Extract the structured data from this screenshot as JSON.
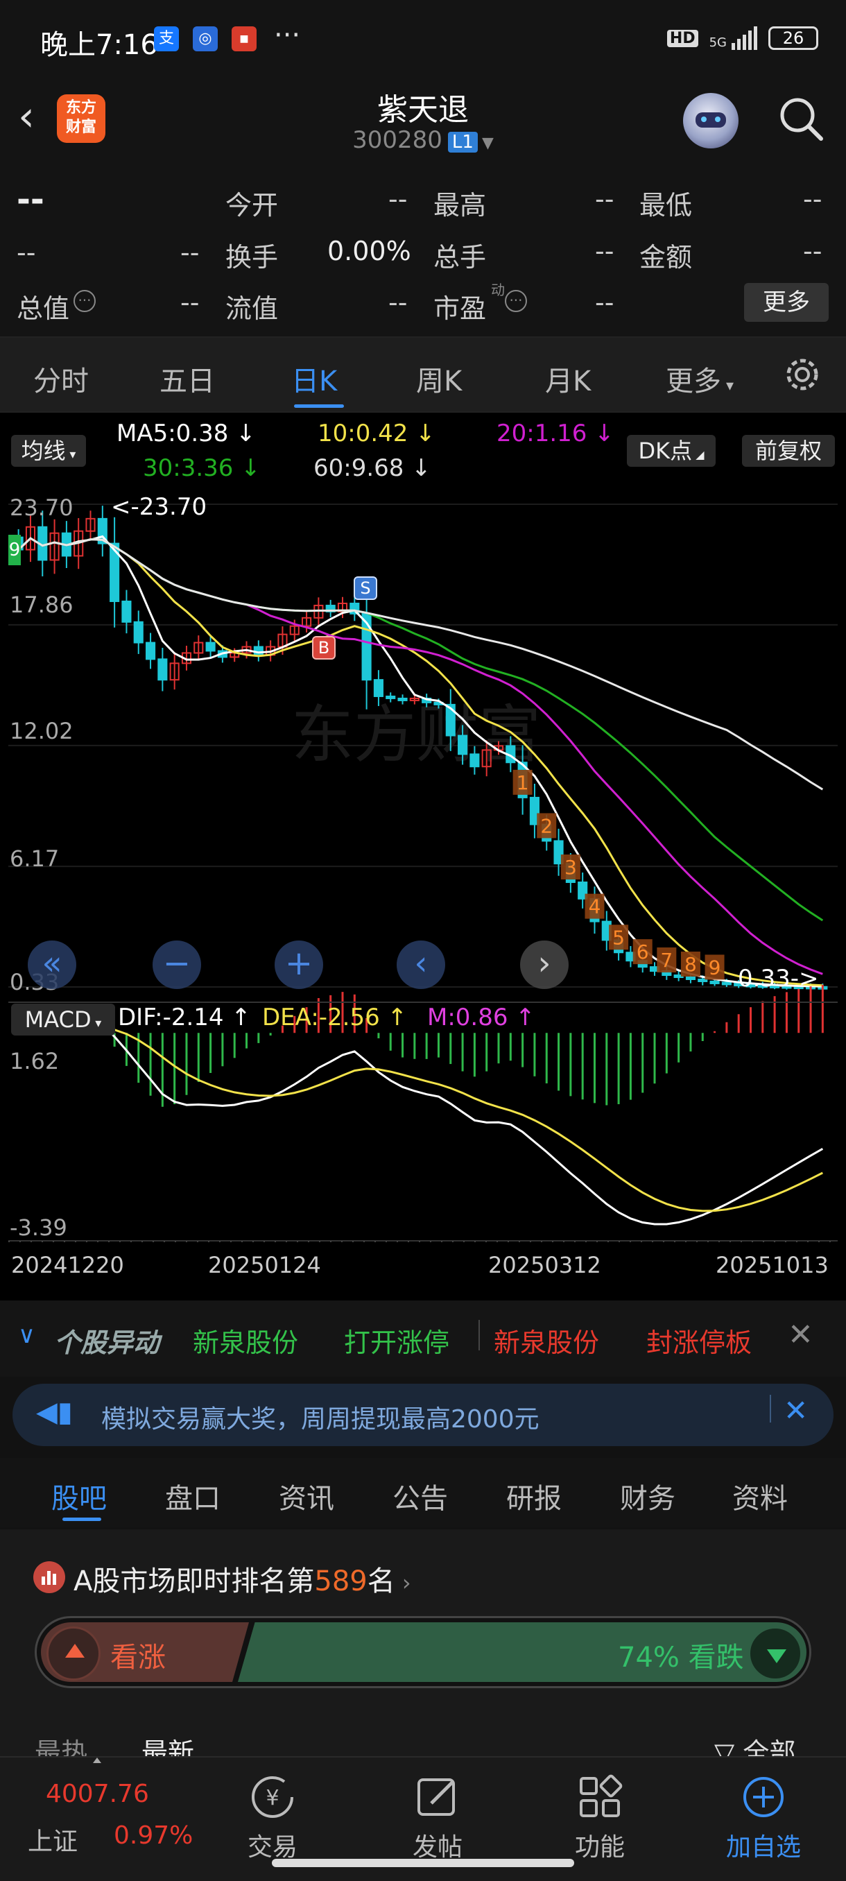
{
  "status_bar": {
    "time": "晚上7:16",
    "dots": "···",
    "hd": "HD",
    "signal": "5G",
    "battery": "26"
  },
  "header": {
    "logo": "东方\n财富",
    "title": "紫天退",
    "code": "300280",
    "level": "L1"
  },
  "quote": {
    "price": "--",
    "change": "--",
    "change_pct": "--",
    "fields": [
      {
        "label": "今开",
        "value": "--"
      },
      {
        "label": "最高",
        "value": "--"
      },
      {
        "label": "最低",
        "value": "--"
      },
      {
        "label": "换手",
        "value": "0.00%"
      },
      {
        "label": "总手",
        "value": "--"
      },
      {
        "label": "金额",
        "value": "--"
      },
      {
        "label": "总值",
        "value": "--"
      },
      {
        "label": "流值",
        "value": "--"
      },
      {
        "label": "市盈",
        "value": "--"
      }
    ],
    "pe_sup": "动",
    "more": "更多"
  },
  "tabs": [
    "分时",
    "五日",
    "日K",
    "周K",
    "月K",
    "更多"
  ],
  "active_tab": "日K",
  "chart": {
    "ma_selector": "均线",
    "ma": {
      "ma5": "MA5:0.38",
      "ma10": "10:0.42",
      "ma20": "20:1.16",
      "ma30": "30:3.36",
      "ma60": "60:9.68"
    },
    "dk": "DK点",
    "adjust": "前复权",
    "y_labels": [
      "23.70",
      "17.86",
      "12.02",
      "6.17",
      "0.33"
    ],
    "high_marker": "<-23.70",
    "low_marker": "0.33->",
    "watermark": "东方财富",
    "markers": {
      "s": "S",
      "b": "B"
    },
    "td_numbers": [
      "1",
      "2",
      "3",
      "4",
      "5",
      "6",
      "7",
      "8",
      "9"
    ],
    "td_left_9": "9",
    "macd_selector": "MACD",
    "macd": {
      "dif": "DIF:-2.14",
      "dea": "DEA:-2.56",
      "m": "M:0.86"
    },
    "macd_y": [
      "1.62",
      "-3.39"
    ],
    "dates": [
      "20241220",
      "20250124",
      "20250312",
      "20251013"
    ],
    "colors": {
      "up": "#e03232",
      "down": "#1ec8d8",
      "ma5": "#ffffff",
      "ma10": "#f2e24a",
      "ma20": "#d020d0",
      "ma30": "#22b022",
      "ma60": "#e8e8e8"
    }
  },
  "chart_data": {
    "type": "candlestick",
    "ylim": [
      0.33,
      23.7
    ],
    "close_series": [
      21.5,
      22.6,
      21.0,
      22.3,
      21.2,
      22.4,
      23.0,
      21.8,
      19.0,
      18.0,
      17.0,
      16.2,
      15.2,
      16.0,
      16.5,
      17.0,
      16.6,
      16.3,
      16.5,
      16.8,
      16.4,
      16.8,
      17.4,
      17.8,
      18.2,
      18.8,
      18.5,
      18.9,
      18.4,
      15.2,
      14.4,
      14.3,
      14.2,
      14.3,
      14.1,
      14.0,
      12.5,
      11.6,
      11.0,
      11.8,
      12.0,
      11.2,
      9.5,
      8.2,
      7.4,
      6.3,
      5.4,
      4.6,
      3.5,
      2.6,
      2.0,
      1.6,
      1.3,
      1.1,
      0.9,
      0.8,
      0.7,
      0.6,
      0.55,
      0.5,
      0.45,
      0.42,
      0.4,
      0.38,
      0.36,
      0.35,
      0.34,
      0.33
    ]
  },
  "alert": {
    "title": "个股异动",
    "items": [
      {
        "text": "新泉股份",
        "color": "#33c24a"
      },
      {
        "text": "打开涨停",
        "color": "#33c24a"
      },
      {
        "text": "新泉股份",
        "color": "#e8392d"
      },
      {
        "text": "封涨停板",
        "color": "#e8392d"
      }
    ]
  },
  "banner": {
    "text": "模拟交易赢大奖，周周提现最高2000元"
  },
  "bottom_tabs": [
    "股吧",
    "盘口",
    "资讯",
    "公告",
    "研报",
    "财务",
    "资料"
  ],
  "active_bottom_tab": "股吧",
  "rank": {
    "prefix": "A股市场即时排名第",
    "number": "589",
    "suffix": "名"
  },
  "vote": {
    "up_label": "看涨",
    "down_label": "74% 看跌",
    "down_pct": 74
  },
  "feed": {
    "left1": "最热",
    "left2": "最新",
    "right": "全部"
  },
  "bottom_nav": {
    "index_value": "4007.76",
    "index_name": "上证",
    "index_pct": "0.97%",
    "items": [
      "交易",
      "发帖",
      "功能",
      "加自选"
    ]
  }
}
